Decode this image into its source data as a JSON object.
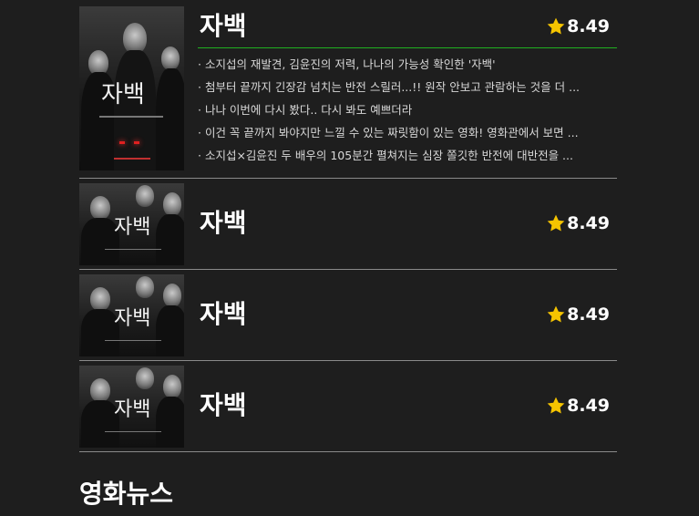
{
  "featured": {
    "title": "자백",
    "rating": "8.49",
    "poster_title": "자백",
    "reviews": [
      "· 소지섭의 재발견, 김윤진의 저력, 나나의 가능성 확인한 '자백'",
      "· 첨부터 끝까지 긴장감 넘치는 반전 스릴러...!! 원작 안보고 관람하는 것을 더 ...",
      "· 나나 이번에 다시 봤다.. 다시 봐도 예쁘더라",
      "· 이건 꼭 끝까지 봐야지만 느낄 수 있는 짜릿함이 있는 영화! 영화관에서 보면 ...",
      "· 소지섭×김윤진 두 배우의 105분간 펼쳐지는 심장 쫄깃한 반전에 대반전을 ..."
    ]
  },
  "items": [
    {
      "title": "자백",
      "rating": "8.49",
      "poster_title": "자백"
    },
    {
      "title": "자백",
      "rating": "8.49",
      "poster_title": "자백"
    },
    {
      "title": "자백",
      "rating": "8.49",
      "poster_title": "자백"
    }
  ],
  "section": {
    "title": "영화뉴스"
  },
  "colors": {
    "background": "#1e1e1e",
    "accent_line": "#20b020",
    "star": "#f5c400"
  },
  "icons": {
    "rating": "star-icon"
  }
}
